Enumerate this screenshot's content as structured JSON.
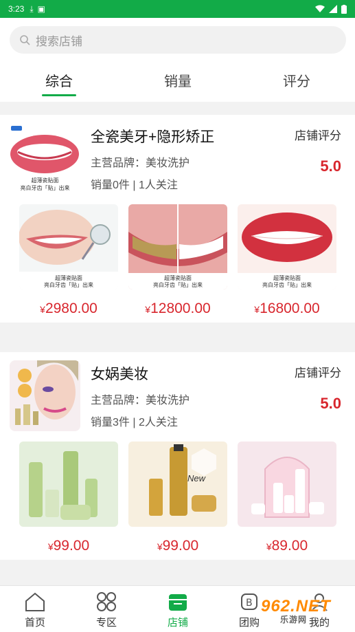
{
  "status": {
    "time": "3:23"
  },
  "search": {
    "placeholder": "搜索店铺"
  },
  "tabs": [
    "综合",
    "销量",
    "评分"
  ],
  "shops": [
    {
      "name": "全瓷美牙+隐形矫正",
      "brand": "主营品牌：美妆洗护",
      "sales": "销量0件 | 1人关注",
      "rating_label": "店铺评分",
      "rating": "5.0",
      "logo_caption": "超薄瓷贴面",
      "logo_caption2": "亮白牙齿「贴」出来",
      "products": [
        {
          "price": "2980.00",
          "caption": "超薄瓷贴面",
          "caption2": "亮白牙齿「贴」出来"
        },
        {
          "price": "12800.00",
          "caption": "超薄瓷贴面",
          "caption2": "亮白牙齿「贴」出来"
        },
        {
          "price": "16800.00",
          "caption": "超薄瓷贴面",
          "caption2": "亮白牙齿「贴」出来"
        }
      ]
    },
    {
      "name": "女娲美妆",
      "brand": "主营品牌：美妆洗护",
      "sales": "销量3件 | 2人关注",
      "rating_label": "店铺评分",
      "rating": "5.0",
      "products": [
        {
          "price": "99.00"
        },
        {
          "price": "99.00",
          "caption": "New"
        },
        {
          "price": "89.00"
        }
      ]
    }
  ],
  "currency": "¥",
  "bottom_nav": [
    "首页",
    "专区",
    "店铺",
    "团购",
    "我的"
  ],
  "watermark": {
    "main": "962.NET",
    "sub": "乐游网"
  },
  "colors": {
    "brand": "#12ab48",
    "price": "#d8262d"
  }
}
